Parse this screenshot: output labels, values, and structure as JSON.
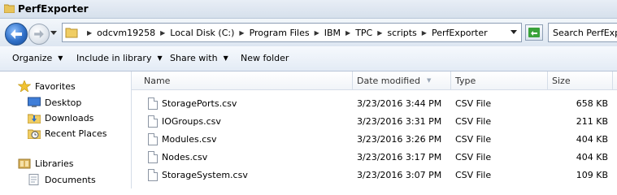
{
  "window": {
    "title": "PerfExporter"
  },
  "address": {
    "crumbs": [
      "odcvm19258",
      "Local Disk (C:)",
      "Program Files",
      "IBM",
      "TPC",
      "scripts",
      "PerfExporter"
    ]
  },
  "search": {
    "placeholder": "Search PerfExporter"
  },
  "toolbar": {
    "organize": "Organize",
    "include_in_library": "Include in library",
    "share_with": "Share with",
    "new_folder": "New folder"
  },
  "nav": {
    "favorites": "Favorites",
    "desktop": "Desktop",
    "downloads": "Downloads",
    "recent_places": "Recent Places",
    "libraries": "Libraries",
    "documents": "Documents"
  },
  "columns": {
    "name": "Name",
    "date_modified": "Date modified",
    "type": "Type",
    "size": "Size"
  },
  "files": [
    {
      "name": "StoragePorts.csv",
      "date": "3/23/2016 3:44 PM",
      "type": "CSV File",
      "size": "658 KB"
    },
    {
      "name": "IOGroups.csv",
      "date": "3/23/2016 3:31 PM",
      "type": "CSV File",
      "size": "211 KB"
    },
    {
      "name": "Modules.csv",
      "date": "3/23/2016 3:26 PM",
      "type": "CSV File",
      "size": "404 KB"
    },
    {
      "name": "Nodes.csv",
      "date": "3/23/2016 3:17 PM",
      "type": "CSV File",
      "size": "404 KB"
    },
    {
      "name": "StorageSystem.csv",
      "date": "3/23/2016 3:07 PM",
      "type": "CSV File",
      "size": "109 KB"
    }
  ]
}
